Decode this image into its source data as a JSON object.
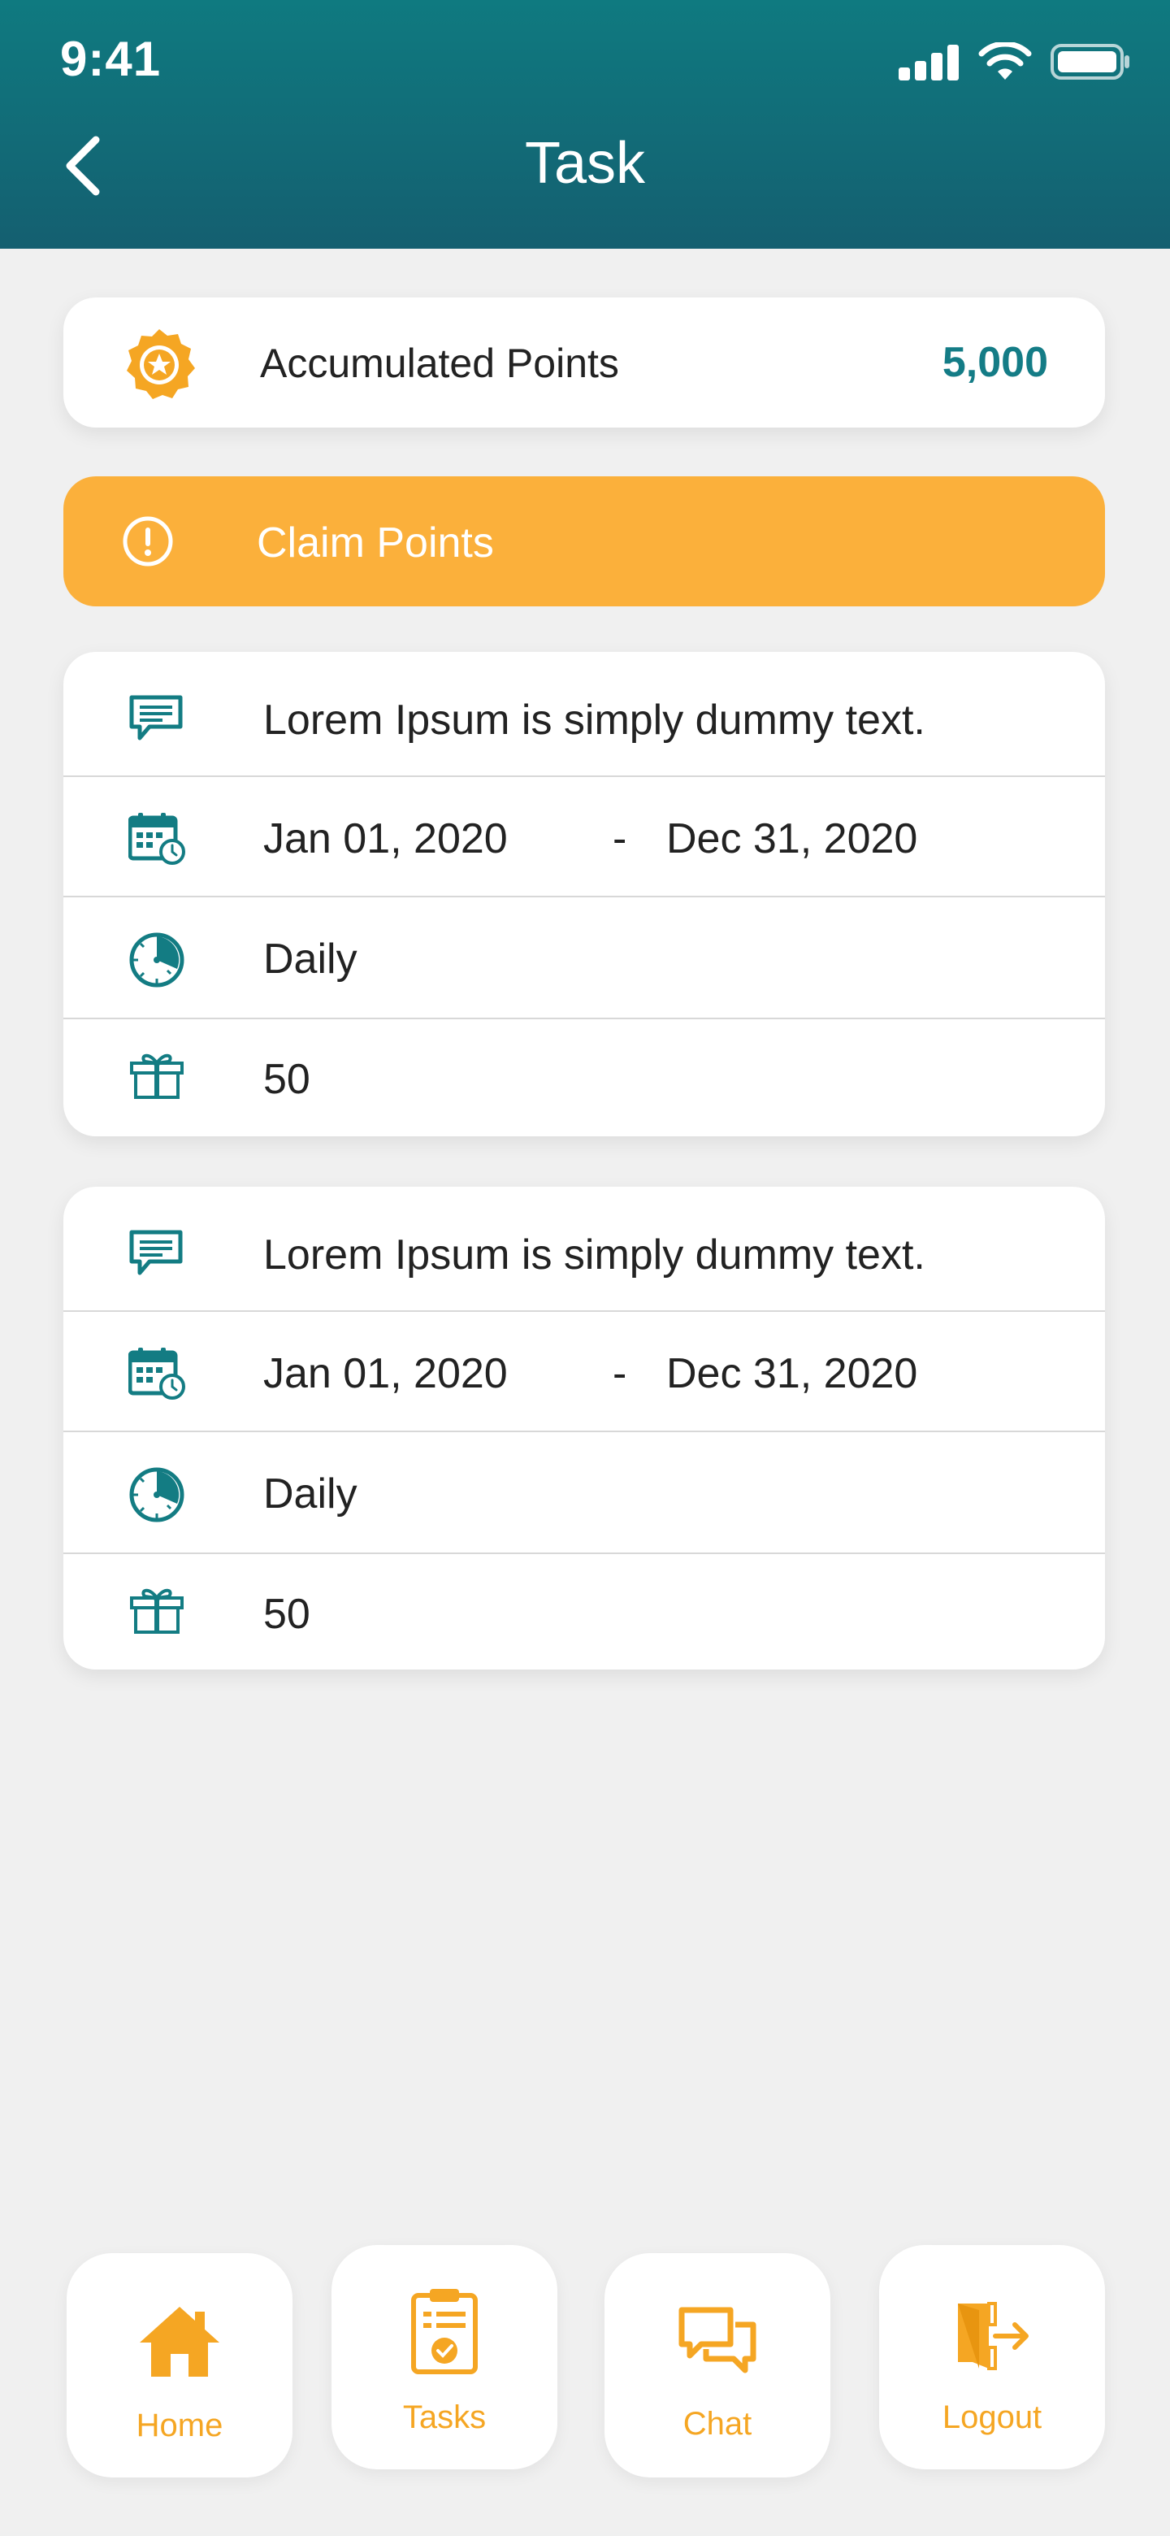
{
  "status_bar": {
    "time": "9:41"
  },
  "header": {
    "title": "Task"
  },
  "points": {
    "label": "Accumulated Points",
    "value": "5,000"
  },
  "claim": {
    "label": "Claim Points"
  },
  "tasks": [
    {
      "description": "Lorem Ipsum is simply dummy text.",
      "start_date": "Jan 01, 2020",
      "separator": "-",
      "end_date": "Dec 31, 2020",
      "frequency": "Daily",
      "reward": "50"
    },
    {
      "description": "Lorem Ipsum is simply dummy text.",
      "start_date": "Jan 01, 2020",
      "separator": "-",
      "end_date": "Dec 31, 2020",
      "frequency": "Daily",
      "reward": "50"
    }
  ],
  "bottom_nav": [
    {
      "label": "Home",
      "icon": "home-icon"
    },
    {
      "label": "Tasks",
      "icon": "clipboard-check-icon"
    },
    {
      "label": "Chat",
      "icon": "chat-icon"
    },
    {
      "label": "Logout",
      "icon": "logout-icon"
    }
  ],
  "colors": {
    "header": "#0f7a80",
    "accent": "#fbb03b",
    "teal": "#147c86",
    "nav_orange": "#f5a623"
  }
}
